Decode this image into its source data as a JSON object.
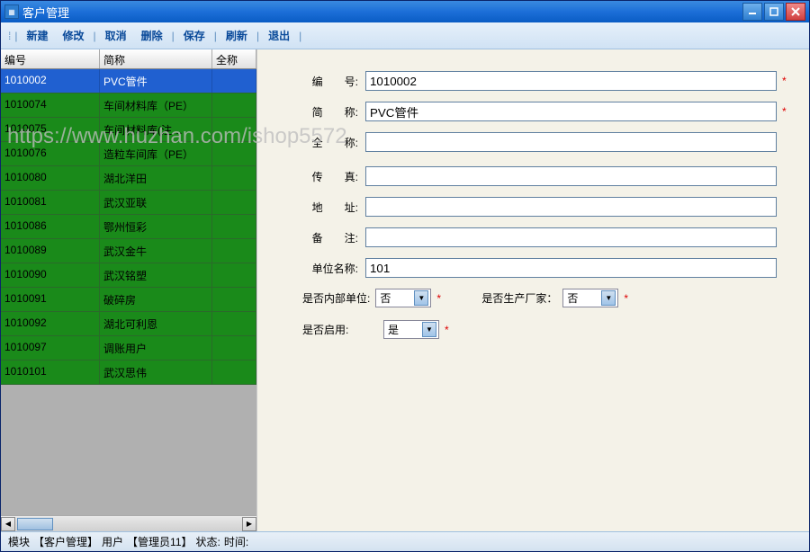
{
  "window": {
    "title": "客户管理"
  },
  "toolbar": {
    "new": "新建",
    "edit": "修改",
    "cancel": "取消",
    "delete": "删除",
    "save": "保存",
    "refresh": "刷新",
    "exit": "退出"
  },
  "grid": {
    "headers": {
      "id": "编号",
      "short": "简称",
      "full": "全称"
    },
    "rows": [
      {
        "id": "1010002",
        "short": "PVC管件",
        "selected": true
      },
      {
        "id": "1010074",
        "short": "车间材料库（PE）"
      },
      {
        "id": "1010075",
        "short": "车间材料库(注…"
      },
      {
        "id": "1010076",
        "short": "造粒车间库（PE）"
      },
      {
        "id": "1010080",
        "short": "湖北洋田"
      },
      {
        "id": "1010081",
        "short": "武汉亚联"
      },
      {
        "id": "1010086",
        "short": "鄂州恒彩"
      },
      {
        "id": "1010089",
        "short": "武汉金牛"
      },
      {
        "id": "1010090",
        "short": "武汉铭塑"
      },
      {
        "id": "1010091",
        "short": "破碎房"
      },
      {
        "id": "1010092",
        "short": "湖北可利恩"
      },
      {
        "id": "1010097",
        "short": "调账用户"
      },
      {
        "id": "1010101",
        "short": "武汉思伟"
      }
    ]
  },
  "form": {
    "labels": {
      "id": "编　　号:",
      "short": "简　　称:",
      "full": "全　　称:",
      "fax": "传　　真:",
      "addr": "地　　址:",
      "remark": "备　　注:",
      "unit": "单位名称:",
      "internal": "是否内部单位:",
      "manufacturer": "是否生产厂家：",
      "enabled": "是否启用:"
    },
    "values": {
      "id": "1010002",
      "short": "PVC管件",
      "full": "",
      "fax": "",
      "addr": "",
      "remark": "",
      "unit": "101",
      "internal": "否",
      "manufacturer": "否",
      "enabled": "是"
    }
  },
  "status": {
    "module_label": "模块",
    "module_val": "【客户管理】",
    "user_label": "用户",
    "user_val": "【管理员11】",
    "state_label": "状态:",
    "time_label": "时间:"
  },
  "watermark": "https://www.huzhan.com/ishop5572"
}
